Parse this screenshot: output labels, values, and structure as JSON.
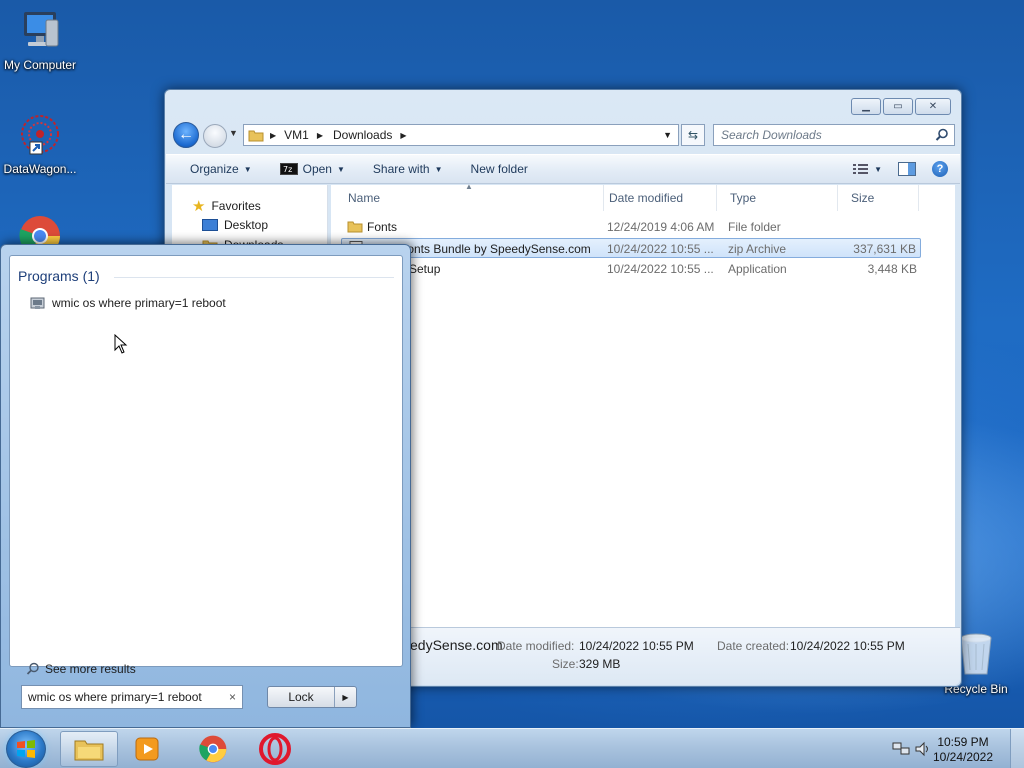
{
  "desktop": {
    "icons": [
      {
        "label": "My Computer",
        "icon": "computer-icon"
      },
      {
        "label": "DataWagon...",
        "icon": "datawagon-shortcut-icon"
      },
      {
        "label": "Recycle Bin",
        "icon": "recycle-bin-icon"
      }
    ]
  },
  "explorer": {
    "address": {
      "segments": [
        "VM1",
        "Downloads"
      ]
    },
    "search_placeholder": "Search Downloads",
    "toolbar": {
      "organize": "Organize",
      "open": "Open",
      "share_with": "Share with",
      "new_folder": "New folder"
    },
    "nav_pane": {
      "favorites": "Favorites",
      "desktop": "Desktop",
      "downloads": "Downloads"
    },
    "columns": {
      "name": "Name",
      "date_modified": "Date modified",
      "type": "Type",
      "size": "Size"
    },
    "files": [
      {
        "name": "Fonts",
        "date": "12/24/2019 4:06 AM",
        "type": "File folder",
        "size": ""
      },
      {
        "name": "Fonts Bundle by SpeedySense.com",
        "date": "10/24/2022 10:55 ...",
        "type": "zip Archive",
        "size": "337,631 KB"
      },
      {
        "name": "XSetup",
        "date": "10/24/2022 10:55 ...",
        "type": "Application",
        "size": "3,448 KB"
      }
    ],
    "details": {
      "name": "edySense.com",
      "date_modified_label": "Date modified:",
      "date_modified": "10/24/2022 10:55 PM",
      "date_created_label": "Date created:",
      "date_created": "10/24/2022 10:55 PM",
      "size_label": "Size:",
      "size": "329 MB"
    }
  },
  "startmenu": {
    "programs_heading": "Programs (1)",
    "program_result": "wmic os where primary=1 reboot",
    "see_more": "See more results",
    "search_value": "wmic os where primary=1 reboot",
    "clear": "×",
    "lock_label": "Lock"
  },
  "taskbar": {
    "time": "10:59 PM",
    "date": "10/24/2022"
  }
}
